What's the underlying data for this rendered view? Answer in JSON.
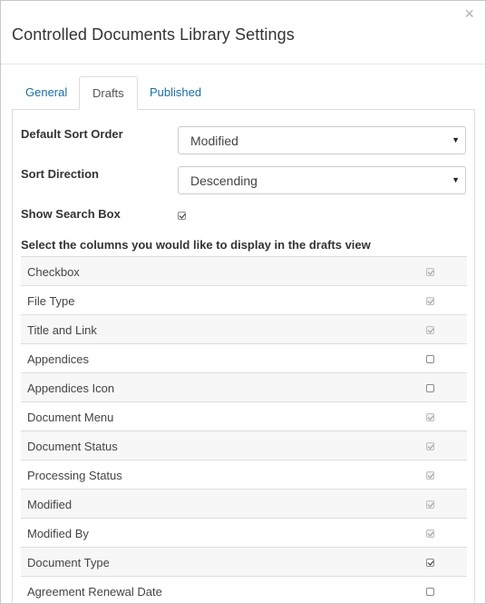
{
  "dialog": {
    "title": "Controlled Documents Library Settings",
    "close_symbol": "×"
  },
  "tabs": [
    {
      "label": "General",
      "active": false
    },
    {
      "label": "Drafts",
      "active": true
    },
    {
      "label": "Published",
      "active": false
    }
  ],
  "form": {
    "sort_order": {
      "label": "Default Sort Order",
      "value": "Modified"
    },
    "sort_direction": {
      "label": "Sort Direction",
      "value": "Descending"
    },
    "search_box": {
      "label": "Show Search Box",
      "checked": true
    }
  },
  "columns_heading": "Select the columns you would like to display in the drafts view",
  "columns": [
    {
      "name": "Checkbox",
      "checked": true,
      "disabled": true
    },
    {
      "name": "File Type",
      "checked": true,
      "disabled": true
    },
    {
      "name": "Title and Link",
      "checked": true,
      "disabled": true
    },
    {
      "name": "Appendices",
      "checked": false,
      "disabled": false
    },
    {
      "name": "Appendices Icon",
      "checked": false,
      "disabled": false
    },
    {
      "name": "Document Menu",
      "checked": true,
      "disabled": true
    },
    {
      "name": "Document Status",
      "checked": true,
      "disabled": true
    },
    {
      "name": "Processing Status",
      "checked": true,
      "disabled": true
    },
    {
      "name": "Modified",
      "checked": true,
      "disabled": true
    },
    {
      "name": "Modified By",
      "checked": true,
      "disabled": true
    },
    {
      "name": "Document Type",
      "checked": true,
      "disabled": false
    },
    {
      "name": "Agreement Renewal Date",
      "checked": false,
      "disabled": false
    }
  ],
  "colors": {
    "link": "#1a6fa6",
    "border": "#dddddd"
  }
}
